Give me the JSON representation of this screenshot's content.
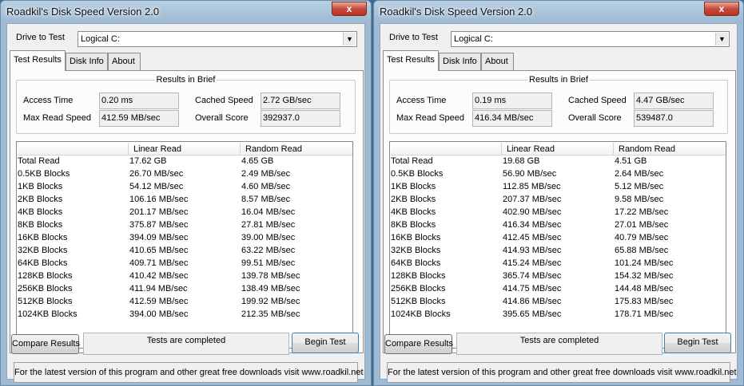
{
  "windows": [
    {
      "title": "Roadkil's Disk Speed Version 2.0",
      "close_glyph": "x",
      "drive_label": "Drive to Test",
      "drive_value": "Logical C:",
      "tabs": [
        "Test Results",
        "Disk Info",
        "About"
      ],
      "brief_title": "Results in Brief",
      "access_time_label": "Access Time",
      "access_time": "0.20 ms",
      "cached_speed_label": "Cached Speed",
      "cached_speed": "2.72 GB/sec",
      "max_read_label": "Max Read Speed",
      "max_read": "412.59 MB/sec",
      "overall_label": "Overall Score",
      "overall": "392937.0",
      "columns": [
        "",
        "Linear Read",
        "Random Read"
      ],
      "rows": [
        [
          "Total Read",
          "17.62 GB",
          "4.65 GB"
        ],
        [
          "0.5KB Blocks",
          "26.70 MB/sec",
          "2.49 MB/sec"
        ],
        [
          "1KB Blocks",
          "54.12 MB/sec",
          "4.60 MB/sec"
        ],
        [
          "2KB Blocks",
          "106.16 MB/sec",
          "8.57 MB/sec"
        ],
        [
          "4KB Blocks",
          "201.17 MB/sec",
          "16.04 MB/sec"
        ],
        [
          "8KB Blocks",
          "375.87 MB/sec",
          "27.81 MB/sec"
        ],
        [
          "16KB Blocks",
          "394.09 MB/sec",
          "39.00 MB/sec"
        ],
        [
          "32KB Blocks",
          "410.65 MB/sec",
          "63.22 MB/sec"
        ],
        [
          "64KB Blocks",
          "409.71 MB/sec",
          "99.51 MB/sec"
        ],
        [
          "128KB Blocks",
          "410.42 MB/sec",
          "139.78 MB/sec"
        ],
        [
          "256KB Blocks",
          "411.94 MB/sec",
          "138.49 MB/sec"
        ],
        [
          "512KB Blocks",
          "412.59 MB/sec",
          "199.92 MB/sec"
        ],
        [
          "1024KB Blocks",
          "394.00 MB/sec",
          "212.35 MB/sec"
        ]
      ],
      "compare_button": "Compare Results",
      "status": "Tests are completed",
      "begin_button": "Begin Test",
      "footer": "For the latest version of this program and other great free downloads visit www.roadkil.net"
    },
    {
      "title": "Roadkil's Disk Speed Version 2.0",
      "close_glyph": "x",
      "drive_label": "Drive to Test",
      "drive_value": "Logical C:",
      "tabs": [
        "Test Results",
        "Disk Info",
        "About"
      ],
      "brief_title": "Results in Brief",
      "access_time_label": "Access Time",
      "access_time": "0.19 ms",
      "cached_speed_label": "Cached Speed",
      "cached_speed": "4.47 GB/sec",
      "max_read_label": "Max Read Speed",
      "max_read": "416.34 MB/sec",
      "overall_label": "Overall Score",
      "overall": "539487.0",
      "columns": [
        "",
        "Linear Read",
        "Random Read"
      ],
      "rows": [
        [
          "Total Read",
          "19.68 GB",
          "4.51 GB"
        ],
        [
          "0.5KB Blocks",
          "56.90 MB/sec",
          "2.64 MB/sec"
        ],
        [
          "1KB Blocks",
          "112.85 MB/sec",
          "5.12 MB/sec"
        ],
        [
          "2KB Blocks",
          "207.37 MB/sec",
          "9.58 MB/sec"
        ],
        [
          "4KB Blocks",
          "402.90 MB/sec",
          "17.22 MB/sec"
        ],
        [
          "8KB Blocks",
          "416.34 MB/sec",
          "27.01 MB/sec"
        ],
        [
          "16KB Blocks",
          "412.45 MB/sec",
          "40.79 MB/sec"
        ],
        [
          "32KB Blocks",
          "414.93 MB/sec",
          "65.88 MB/sec"
        ],
        [
          "64KB Blocks",
          "415.24 MB/sec",
          "101.24 MB/sec"
        ],
        [
          "128KB Blocks",
          "365.74 MB/sec",
          "154.32 MB/sec"
        ],
        [
          "256KB Blocks",
          "414.75 MB/sec",
          "144.48 MB/sec"
        ],
        [
          "512KB Blocks",
          "414.86 MB/sec",
          "175.83 MB/sec"
        ],
        [
          "1024KB Blocks",
          "395.65 MB/sec",
          "178.71 MB/sec"
        ]
      ],
      "compare_button": "Compare Results",
      "status": "Tests are completed",
      "begin_button": "Begin Test",
      "footer": "For the latest version of this program and other great free downloads visit www.roadkil.net"
    }
  ]
}
